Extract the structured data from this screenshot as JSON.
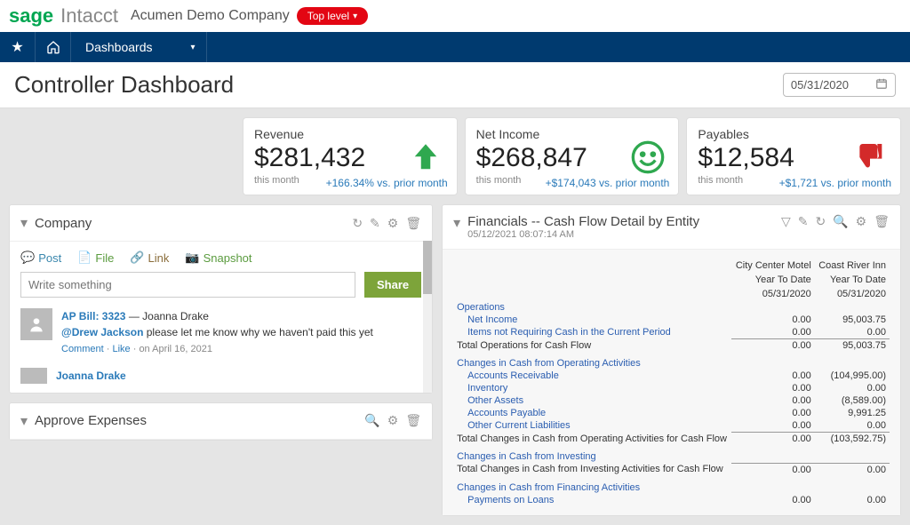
{
  "header": {
    "brand1": "sage",
    "brand2": "Intacct",
    "company": "Acumen Demo Company",
    "pill": "Top level"
  },
  "nav": {
    "item": "Dashboards"
  },
  "page": {
    "title": "Controller Dashboard",
    "date": "05/31/2020"
  },
  "kpi": [
    {
      "label": "Revenue",
      "value": "$281,432",
      "sub": "this month",
      "trend": "+166.34% vs. prior month"
    },
    {
      "label": "Net Income",
      "value": "$268,847",
      "sub": "this month",
      "trend": "+$174,043 vs. prior month"
    },
    {
      "label": "Payables",
      "value": "$12,584",
      "sub": "this month",
      "trend": "+$1,721 vs. prior month"
    }
  ],
  "company_panel": {
    "title": "Company",
    "tabs": {
      "post": "Post",
      "file": "File",
      "link": "Link",
      "snapshot": "Snapshot"
    },
    "placeholder": "Write something",
    "share": "Share",
    "item1_title": "AP Bill: 3323",
    "item1_author": "Joanna Drake",
    "item1_mention": "@Drew Jackson",
    "item1_body": " please let me know why we haven't paid this yet",
    "item1_comment": "Comment",
    "item1_like": "Like",
    "item1_date": "on April 16, 2021",
    "item2_author": "Joanna Drake"
  },
  "approve_panel": {
    "title": "Approve Expenses"
  },
  "cashflow": {
    "title": "Financials -- Cash Flow Detail by Entity",
    "timestamp": "05/12/2021 08:07:14 AM",
    "col1h1": "City Center Motel",
    "col1h2": "Year To Date",
    "col1h3": "05/31/2020",
    "col2h1": "Coast River Inn",
    "col2h2": "Year To Date",
    "col2h3": "05/31/2020",
    "rows": {
      "ops": "Operations",
      "ni": "Net Income",
      "ni1": "0.00",
      "ni2": "95,003.75",
      "items": "Items not Requiring Cash in the Current Period",
      "it1": "0.00",
      "it2": "0.00",
      "totops": "Total Operations for Cash Flow",
      "to1": "0.00",
      "to2": "95,003.75",
      "chg": "Changes in Cash from Operating Activities",
      "ar": "Accounts Receivable",
      "ar1": "0.00",
      "ar2": "(104,995.00)",
      "inv": "Inventory",
      "inv1": "0.00",
      "inv2": "0.00",
      "oa": "Other Assets",
      "oa1": "0.00",
      "oa2": "(8,589.00)",
      "ap": "Accounts Payable",
      "ap1": "0.00",
      "ap2": "9,991.25",
      "ocl": "Other Current Liabilities",
      "ocl1": "0.00",
      "ocl2": "0.00",
      "totchg": "Total Changes in Cash from Operating Activities for Cash Flow",
      "tc1": "0.00",
      "tc2": "(103,592.75)",
      "invst": "Changes in Cash from Investing",
      "totinv": "Total Changes in Cash from Investing Activities for Cash Flow",
      "ti1": "0.00",
      "ti2": "0.00",
      "fin": "Changes in Cash from Financing Activities",
      "pol": "Payments on Loans",
      "pol1": "0.00",
      "pol2": "0.00"
    }
  }
}
